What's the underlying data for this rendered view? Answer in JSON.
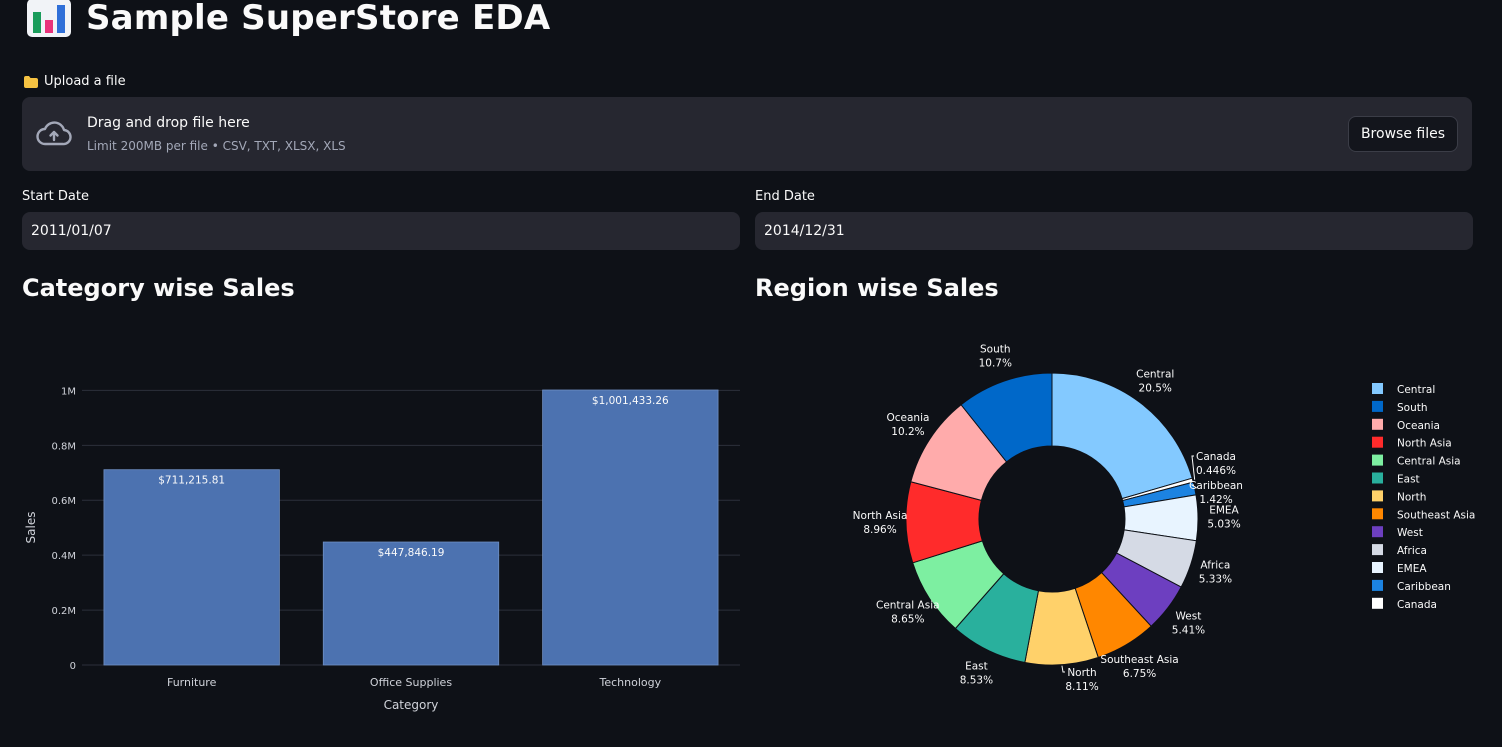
{
  "header": {
    "title": "Sample SuperStore EDA"
  },
  "upload": {
    "label": "Upload a file",
    "drop_text": "Drag and drop file here",
    "limit_text": "Limit 200MB per file • CSV, TXT, XLSX, XLS",
    "browse_label": "Browse files"
  },
  "filters": {
    "start_label": "Start Date",
    "start_value": "2011/01/07",
    "end_label": "End Date",
    "end_value": "2014/12/31"
  },
  "sections": {
    "category_title": "Category wise Sales",
    "region_title": "Region wise Sales"
  },
  "colors": {
    "bar": "#4c72b0",
    "grid": "#2c303b",
    "axis_text": "#d0d3da",
    "background": "#0e1117"
  },
  "chart_data": [
    {
      "type": "bar",
      "categories": [
        "Furniture",
        "Office Supplies",
        "Technology"
      ],
      "values": [
        711215.81,
        447846.19,
        1001433.26
      ],
      "data_labels": [
        "$711,215.81",
        "$447,846.19",
        "$1,001,433.26"
      ],
      "xlabel": "Category",
      "ylabel": "Sales",
      "ylim": [
        0,
        1001433.26
      ],
      "yticks": [
        0,
        200000,
        400000,
        600000,
        800000,
        1000000
      ],
      "ytick_labels": [
        "0",
        "0.2M",
        "0.4M",
        "0.6M",
        "0.8M",
        "1M"
      ],
      "grid": true
    },
    {
      "type": "pie",
      "hole": true,
      "labels": [
        "Central",
        "South",
        "Oceania",
        "North Asia",
        "Central Asia",
        "East",
        "North",
        "Southeast Asia",
        "West",
        "Africa",
        "EMEA",
        "Caribbean",
        "Canada"
      ],
      "values": [
        20.5,
        10.7,
        10.2,
        8.96,
        8.65,
        8.53,
        8.11,
        6.75,
        5.41,
        5.33,
        5.03,
        1.42,
        0.446
      ],
      "percent_labels": [
        "20.5%",
        "10.7%",
        "10.2%",
        "8.96%",
        "8.65%",
        "8.53%",
        "8.11%",
        "6.75%",
        "5.41%",
        "5.33%",
        "5.03%",
        "1.42%",
        "0.446%"
      ],
      "colors": [
        "#83c9ff",
        "#0068c9",
        "#ffabab",
        "#ff2b2b",
        "#7defa1",
        "#29b09d",
        "#ffd16a",
        "#ff8700",
        "#6d3fc0",
        "#d5dae5",
        "#e8f4ff",
        "#1c83e1",
        "#ffffff"
      ],
      "slice_order": [
        "Central",
        "Canada",
        "Caribbean",
        "EMEA",
        "Africa",
        "West",
        "Southeast Asia",
        "North",
        "East",
        "Central Asia",
        "North Asia",
        "Oceania",
        "South"
      ],
      "legend": "right"
    }
  ]
}
